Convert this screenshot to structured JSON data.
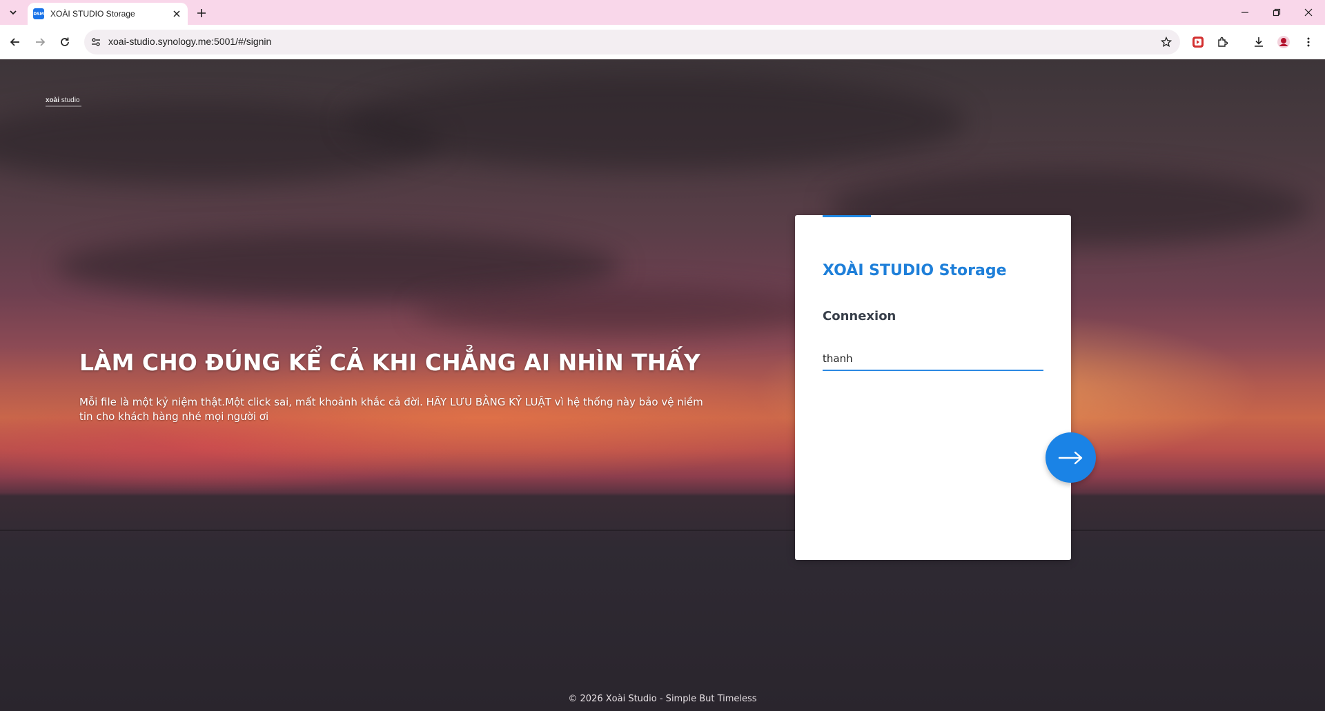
{
  "browser": {
    "tab": {
      "favicon_text": "DSM",
      "title": "XOÀI STUDIO Storage"
    },
    "address_bar": {
      "url": "xoai-studio.synology.me:5001/#/signin"
    },
    "icons": {
      "tab_search": "chevron-down-icon",
      "tab_close": "close-icon",
      "new_tab": "plus-icon",
      "back": "arrow-left-icon",
      "forward": "arrow-right-icon",
      "reload": "reload-icon",
      "site_info": "tune-icon",
      "bookmark": "star-icon",
      "extension_red": "red-extension-icon",
      "extensions": "puzzle-icon",
      "downloads": "download-icon",
      "profile": "avatar-icon",
      "menu": "kebab-menu-icon"
    }
  },
  "page": {
    "logo": {
      "brand_bold": "xoài",
      "brand_light": " studio"
    },
    "hero": {
      "title": "LÀM CHO ĐÚNG KỂ CẢ KHI CHẲNG AI NHÌN THẤY",
      "description": "Mỗi file là một kỷ niệm thật.Một click sai, mất khoảnh khắc cả đời. HÃY LƯU BẰNG KỶ LUẬT vì hệ thống này bảo vệ niềm tin cho khách hàng nhé mọi người ơi"
    },
    "login": {
      "title": "XOÀI STUDIO Storage",
      "subtitle": "Connexion",
      "username_value": "thanh",
      "next_icon": "arrow-right-icon"
    },
    "footer": {
      "text": "© 2026 Xoài Studio - Simple But Timeless"
    }
  },
  "colors": {
    "tabbar_bg": "#f9d7ea",
    "accent_blue": "#1e88e5",
    "card_title": "#1e7fd9",
    "subtitle": "#383f4a"
  }
}
